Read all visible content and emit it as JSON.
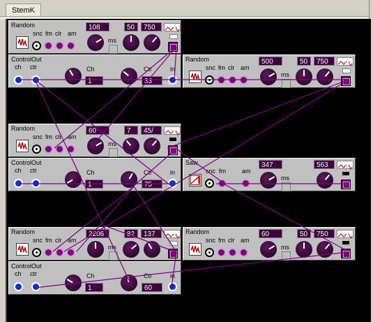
{
  "tab": "StemK",
  "labels": {
    "snc": "snc",
    "fm": "fm",
    "clr": "clr",
    "am": "am",
    "ms": "ms",
    "ch": "ch",
    "ctr": "ctr",
    "Ch": "Ch",
    "Ctr": "Ctr",
    "in": "in"
  },
  "modules": {
    "r1": {
      "title": "Random",
      "v1": "108",
      "v2": "50",
      "v3": "750"
    },
    "c1": {
      "title": "ControlOut",
      "ch": "1",
      "ctr": "33"
    },
    "r2": {
      "title": "Random",
      "v1": "500",
      "v2": "50",
      "v3": "750"
    },
    "r3": {
      "title": "Random",
      "v1": "60",
      "v2": "7",
      "v3": "45/"
    },
    "c2": {
      "title": "ControlOut",
      "ch": "1",
      "ctr": "75"
    },
    "saw": {
      "title": "Saw",
      "v1": "347",
      "v2": "563"
    },
    "r4": {
      "title": "Random",
      "v1": "2206",
      "v2": "82",
      "v3": "137"
    },
    "r5": {
      "title": "Random",
      "v1": "60",
      "v2": "50",
      "v3": "750"
    },
    "c3": {
      "title": "ControlOut",
      "ch": "1",
      "ctr": "60"
    }
  },
  "colors": {
    "canvas": "#000000",
    "module": "#c0c0c0",
    "cable": "#800080",
    "numbox": "#400040",
    "port_blue": "#0030e0"
  }
}
